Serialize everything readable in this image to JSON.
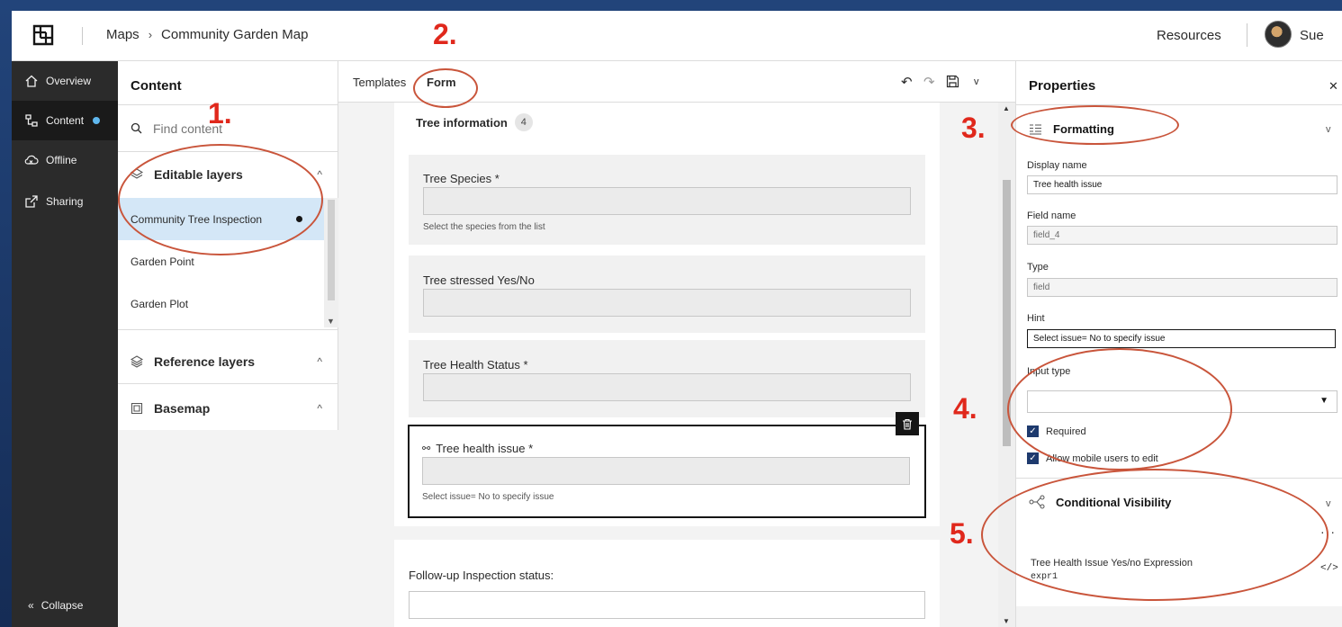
{
  "header": {
    "breadcrumb": [
      "Maps",
      "Community Garden Map"
    ],
    "resources_label": "Resources",
    "user_name": "Sue"
  },
  "leftnav": {
    "items": [
      {
        "label": "Overview",
        "icon": "home-icon"
      },
      {
        "label": "Content",
        "icon": "layers-tree-icon",
        "active": true
      },
      {
        "label": "Offline",
        "icon": "cloud-offline-icon"
      },
      {
        "label": "Sharing",
        "icon": "share-icon"
      }
    ],
    "collapse_label": "Collapse"
  },
  "content": {
    "title": "Content",
    "search_placeholder": "Find content",
    "editable_group": "Editable layers",
    "layers": [
      "Community Tree Inspection",
      "Garden Point",
      "Garden Plot"
    ],
    "reference_group": "Reference layers",
    "basemap_group": "Basemap"
  },
  "form": {
    "tabs": [
      "Templates",
      "Form"
    ],
    "active_tab": "Form",
    "section_title": "Tree information",
    "section_count": "4",
    "fields": [
      {
        "label": "Tree Species *",
        "hint": "Select the species from the list"
      },
      {
        "label": "Tree stressed Yes/No",
        "hint": ""
      },
      {
        "label": "Tree Health Status *",
        "hint": ""
      },
      {
        "label": "Tree health issue *",
        "hint": "Select issue= No to specify issue",
        "selected": true
      }
    ],
    "followup_label": "Follow-up Inspection status:"
  },
  "properties": {
    "title": "Properties",
    "formatting_label": "Formatting",
    "display_name_label": "Display name",
    "display_name_value": "Tree health issue",
    "field_name_label": "Field name",
    "field_name_value": "field_4",
    "type_label": "Type",
    "type_value": "field",
    "hint_label": "Hint",
    "hint_value": "Select issue= No to specify issue",
    "input_type_label": "Input type",
    "required_label": "Required",
    "allow_edit_label": "Allow mobile users to edit",
    "conditional_label": "Conditional Visibility",
    "expression_name": "Tree Health Issue Yes/no Expression",
    "expression_id": "expr1"
  },
  "annotations": [
    "1.",
    "2.",
    "3.",
    "4.",
    "5."
  ],
  "colors": {
    "annotation_ellipse": "#c9553b",
    "annotation_number": "#e0281c",
    "selected_layer_bg": "#d4e7f7",
    "nav_bg": "#2b2b2b",
    "checkbox": "#1e3a6e",
    "status_dot": "#5fb7ee"
  }
}
